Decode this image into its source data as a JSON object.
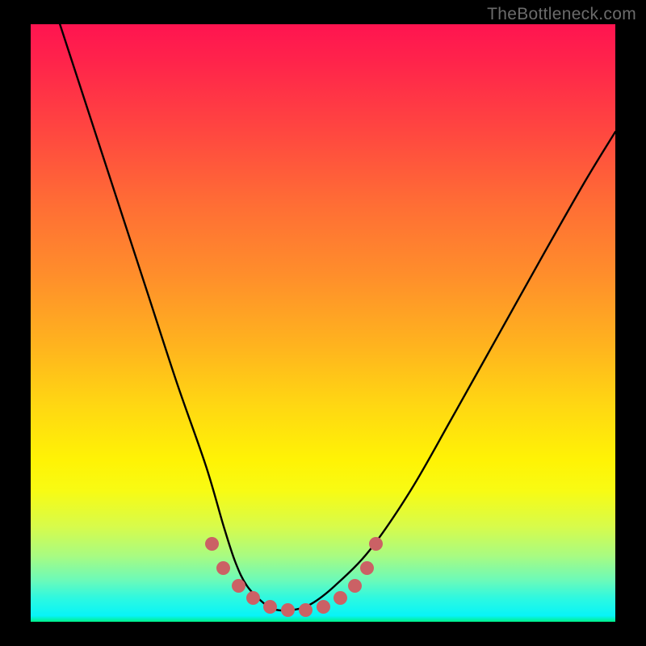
{
  "watermark": "TheBottleneck.com",
  "chart_data": {
    "type": "line",
    "title": "",
    "xlabel": "",
    "ylabel": "",
    "xlim": [
      0,
      100
    ],
    "ylim": [
      0,
      100
    ],
    "series": [
      {
        "name": "bottleneck-curve",
        "x": [
          5,
          10,
          15,
          20,
          25,
          30,
          33,
          35,
          37,
          40,
          42,
          45,
          48,
          52,
          58,
          65,
          72,
          80,
          88,
          95,
          100
        ],
        "y": [
          100,
          85,
          70,
          55,
          40,
          26,
          16,
          10,
          6,
          3,
          2,
          2,
          3,
          6,
          12,
          22,
          34,
          48,
          62,
          74,
          82
        ]
      }
    ],
    "markers": {
      "name": "highlight-points",
      "x": [
        31,
        33,
        35.5,
        38,
        41,
        44,
        47,
        50,
        53,
        55.5,
        57.5,
        59
      ],
      "y": [
        13,
        9,
        6,
        4,
        2.5,
        2,
        2,
        2.5,
        4,
        6,
        9,
        13
      ]
    },
    "background_gradient": {
      "top_color": "#ff1450",
      "bottom_color": "#00f087"
    }
  }
}
